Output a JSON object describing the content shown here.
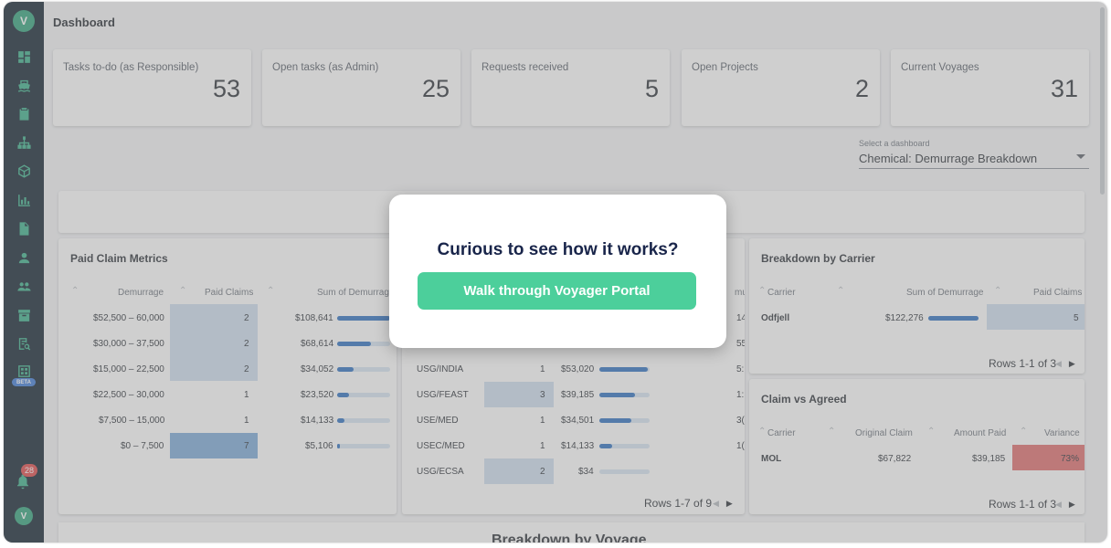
{
  "header": {
    "title": "Dashboard"
  },
  "sidebar": {
    "items": [
      {
        "icon": "dashboard-icon"
      },
      {
        "icon": "ship-icon"
      },
      {
        "icon": "clipboard-icon"
      },
      {
        "icon": "org-chart-icon"
      },
      {
        "icon": "box-icon"
      },
      {
        "icon": "bar-chart-icon"
      },
      {
        "icon": "document-icon"
      },
      {
        "icon": "user-icon"
      },
      {
        "icon": "users-icon"
      },
      {
        "icon": "archive-icon"
      },
      {
        "icon": "search-report-icon"
      },
      {
        "icon": "beta-report-icon"
      }
    ],
    "beta_label": "BETA",
    "notifications_count": "28"
  },
  "kpis": [
    {
      "label": "Tasks to-do (as Responsible)",
      "value": "53"
    },
    {
      "label": "Open tasks (as Admin)",
      "value": "25"
    },
    {
      "label": "Requests received",
      "value": "5"
    },
    {
      "label": "Open Projects",
      "value": "2"
    },
    {
      "label": "Current Voyages",
      "value": "31"
    }
  ],
  "dashboard_select": {
    "label": "Select a dashboard",
    "value": "Chemical: Demurrage Breakdown"
  },
  "paid_claims": {
    "title": "Paid Claim Metrics",
    "headers": [
      "Demurrage",
      "Paid Claims",
      "Sum of Demurrage"
    ],
    "rows": [
      {
        "range": "$52,500 – 60,000",
        "claims": "2",
        "sum": "$108,641",
        "fill": 1.0
      },
      {
        "range": "$30,000 – 37,500",
        "claims": "2",
        "sum": "$68,614",
        "fill": 0.63
      },
      {
        "range": "$15,000 – 22,500",
        "claims": "2",
        "sum": "$34,052",
        "fill": 0.31
      },
      {
        "range": "$22,500 – 30,000",
        "claims": "1",
        "sum": "$23,520",
        "fill": 0.22
      },
      {
        "range": "$7,500 – 15,000",
        "claims": "1",
        "sum": "$14,133",
        "fill": 0.13
      },
      {
        "range": "$0 – 7,500",
        "claims": "7",
        "sum": "$5,106",
        "fill": 0.05
      }
    ]
  },
  "routes": {
    "rows": [
      {
        "route": "USG/INDIA",
        "count": "1",
        "sum": "$53,020",
        "fill": 0.96,
        "tail": "5:"
      },
      {
        "route": "USG/FEAST",
        "count": "3",
        "sum": "$39,185",
        "fill": 0.71,
        "tail": "1:"
      },
      {
        "route": "USE/MED",
        "count": "1",
        "sum": "$34,501",
        "fill": 0.63,
        "tail": "3("
      },
      {
        "route": "USEC/MED",
        "count": "1",
        "sum": "$14,133",
        "fill": 0.26,
        "tail": "1("
      },
      {
        "route": "USG/ECSA",
        "count": "2",
        "sum": "$34",
        "fill": 0.0,
        "tail": ""
      }
    ],
    "upper_tails": [
      "mu",
      "14",
      "55"
    ],
    "rows_info": "Rows 1-7 of 9"
  },
  "carrier": {
    "title": "Breakdown by Carrier",
    "headers": [
      "Carrier",
      "Sum of Demurrage",
      "Paid Claims"
    ],
    "rows": [
      {
        "carrier": "Odfjell",
        "sum": "$122,276",
        "claims": "5",
        "fill": 1.0
      }
    ],
    "rows_info": "Rows 1-1 of 3"
  },
  "claim_vs_agreed": {
    "title": "Claim vs Agreed",
    "headers": [
      "Carrier",
      "Original Claim",
      "Amount Paid",
      "Variance"
    ],
    "rows": [
      {
        "carrier": "MOL",
        "original": "$67,822",
        "paid": "$39,185",
        "variance": "73%"
      }
    ],
    "rows_info": "Rows 1-1 of 3"
  },
  "bottom": {
    "title": "Breakdown by Voyage"
  },
  "modal": {
    "title": "Curious to see how it works?",
    "button": "Walk through Voyager Portal"
  },
  "colors": {
    "accent": "#4ccf9b",
    "sidebar": "#0f1f2d",
    "bar": "#2c6fbf",
    "variance": "#e06b6b"
  }
}
